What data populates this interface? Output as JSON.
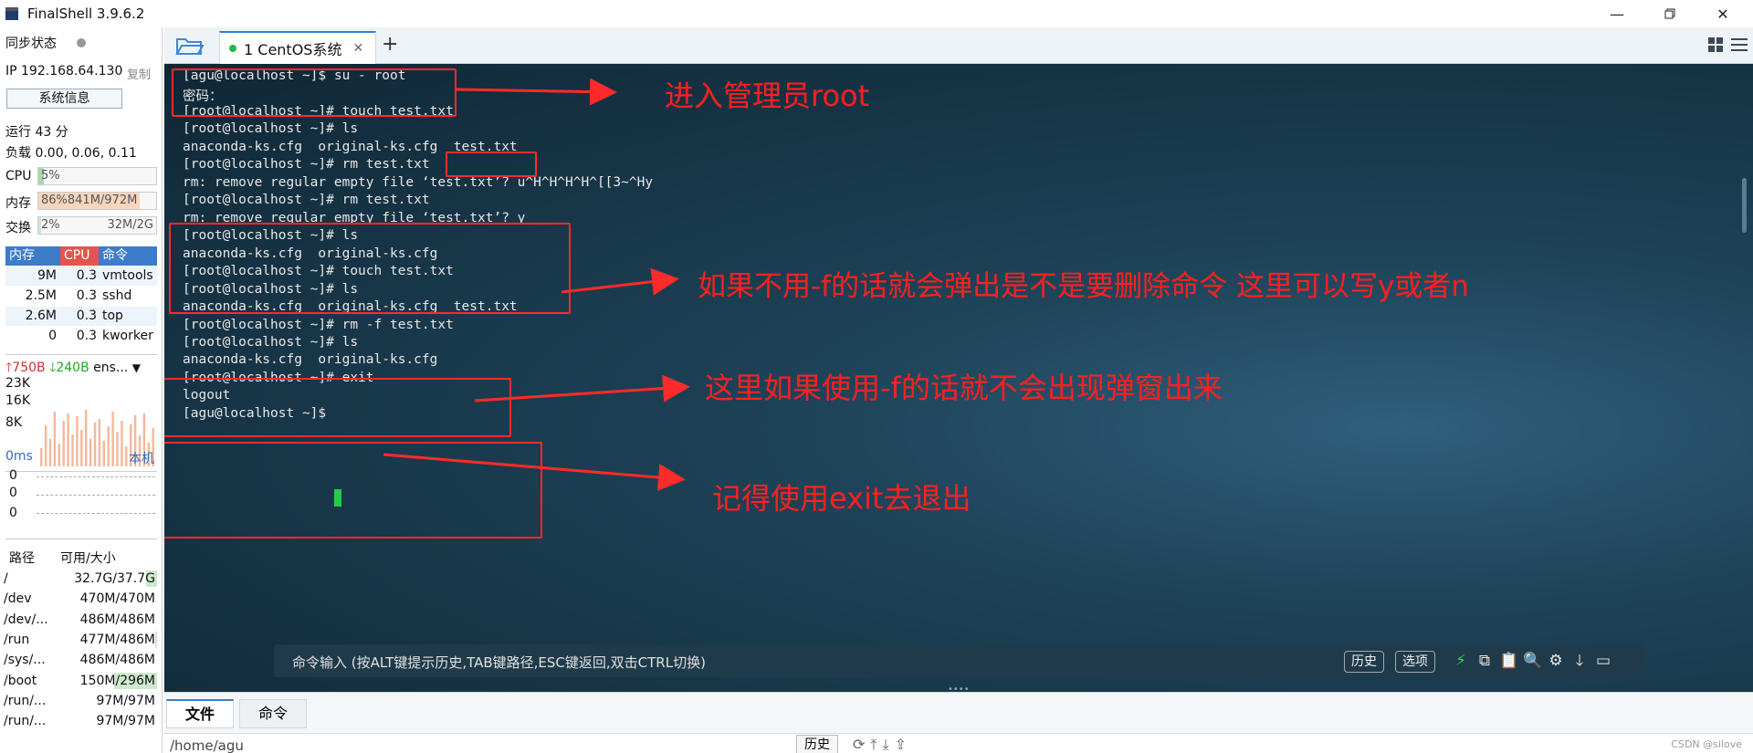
{
  "window": {
    "title": "FinalShell 3.9.6.2"
  },
  "sidebar": {
    "sync_label": "同步状态",
    "ip_label": "IP 192.168.64.130",
    "copy_label": "复制",
    "sysinfo_button": "系统信息",
    "uptime": "运行 43 分",
    "load": "负载 0.00, 0.06, 0.11",
    "cpu": {
      "label": "CPU",
      "value": "5%",
      "fraction": 0.05
    },
    "mem": {
      "label": "内存",
      "value": "86%841M/972M",
      "fraction": 0.86
    },
    "swap": {
      "label": "交换",
      "value": "2%",
      "value2": "32M/2G",
      "fraction": 0.02
    },
    "proc_headers": [
      "内存",
      "CPU",
      "命令"
    ],
    "processes": [
      {
        "mem": "9M",
        "cpu": "0.3",
        "cmd": "vmtools"
      },
      {
        "mem": "2.5M",
        "cpu": "0.3",
        "cmd": "sshd"
      },
      {
        "mem": "2.6M",
        "cpu": "0.3",
        "cmd": "top"
      },
      {
        "mem": "0",
        "cpu": "0.3",
        "cmd": "kworker"
      }
    ],
    "net": {
      "up": "750B",
      "down": "240B",
      "iface": "ens...",
      "y_ticks": [
        "23K",
        "16K",
        "8K"
      ]
    },
    "ping": {
      "label": "0ms",
      "host": "本机",
      "values": [
        "0",
        "0",
        "0"
      ]
    },
    "fs_headers": [
      "路径",
      "可用/大小"
    ],
    "filesystems": [
      {
        "path": "/",
        "size": "32.7G/37.7G",
        "used": 0.13
      },
      {
        "path": "/dev",
        "size": "470M/470M",
        "used": 0.0
      },
      {
        "path": "/dev/...",
        "size": "486M/486M",
        "used": 0.0
      },
      {
        "path": "/run",
        "size": "477M/486M",
        "used": 0.02
      },
      {
        "path": "/sys/...",
        "size": "486M/486M",
        "used": 0.0
      },
      {
        "path": "/boot",
        "size": "150M/296M",
        "used": 0.49
      },
      {
        "path": "/run/...",
        "size": "97M/97M",
        "used": 0.0
      },
      {
        "path": "/run/...",
        "size": "97M/97M",
        "used": 0.0
      }
    ]
  },
  "tabs": {
    "active": "1 CentOS系统",
    "add": "+"
  },
  "terminal": {
    "lines": [
      "[agu@localhost ~]$ su - root",
      "密码：",
      "[root@localhost ~]# touch test.txt",
      "[root@localhost ~]# ls",
      "anaconda-ks.cfg  original-ks.cfg  test.txt",
      "[root@localhost ~]# rm test.txt",
      "rm: remove regular empty file ‘test.txt’? u^H^H^H^H^[[3~^Hy",
      "[root@localhost ~]# rm test.txt",
      "rm: remove regular empty file ‘test.txt’? y",
      "[root@localhost ~]# ls",
      "anaconda-ks.cfg  original-ks.cfg",
      "[root@localhost ~]# touch test.txt",
      "[root@localhost ~]# ls",
      "anaconda-ks.cfg  original-ks.cfg  test.txt",
      "[root@localhost ~]# rm -f test.txt",
      "[root@localhost ~]# ls",
      "anaconda-ks.cfg  original-ks.cfg",
      "[root@localhost ~]# exit",
      "logout",
      "[agu@localhost ~]$ "
    ],
    "annotations": [
      "进入管理员root",
      "如果不用-f的话就会弹出是不是要删除命令 这里可以写y或者n",
      "这里如果使用-f的话就不会出现弹窗出来",
      "记得使用exit去退出"
    ]
  },
  "command_bar": {
    "placeholder": "命令输入 (按ALT键提示历史,TAB键路径,ESC键返回,双击CTRL切换)",
    "history_button": "历史",
    "options_button": "选项"
  },
  "bottom": {
    "tabs": [
      "文件",
      "命令"
    ],
    "path": "/home/agu",
    "history_button": "历史",
    "watermark": "CSDN @silove"
  },
  "colors": {
    "accent": "#2f7fd8",
    "annotation": "#ff2020",
    "cursor": "#22cc44"
  }
}
